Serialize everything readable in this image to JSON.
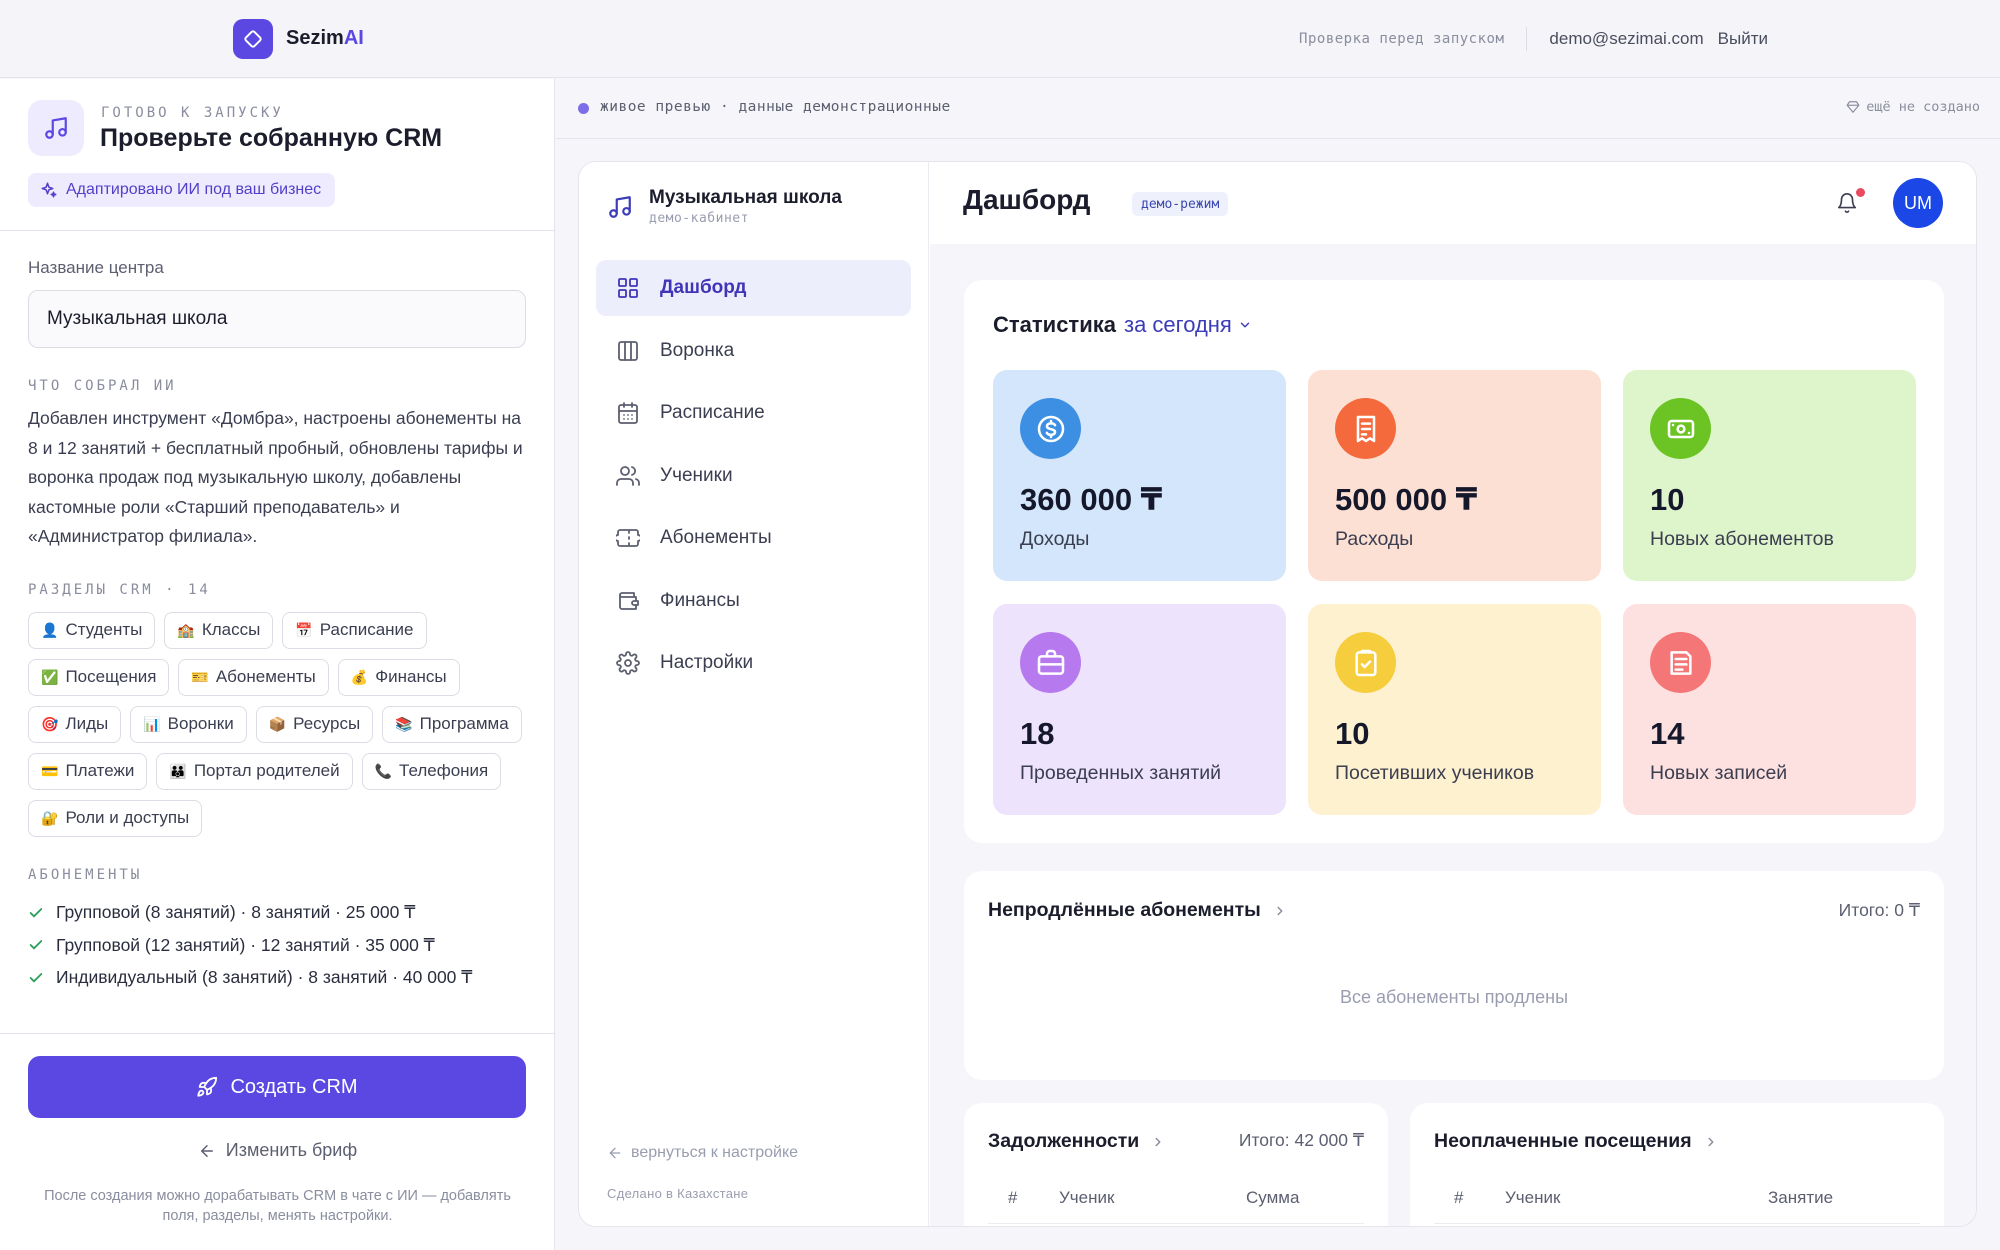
{
  "topbar": {
    "brand_main": "Sezim",
    "brand_accent": "AI",
    "check_label": "Проверка перед запуском",
    "email": "demo@sezimai.com",
    "logout": "Выйти"
  },
  "left": {
    "eyebrow": "ГОТОВО К ЗАПУСКУ",
    "title": "Проверьте собранную CRM",
    "ai_chip": "Адаптировано ИИ под ваш бизнес",
    "center_label": "Название центра",
    "center_value": "Музыкальная школа",
    "ai_section": "ЧТО СОБРАЛ ИИ",
    "ai_text": "Добавлен инструмент «Домбра», настроены абонементы на 8 и 12 занятий + бесплатный пробный, обновлены тарифы и воронка продаж под музыкальную школу, добавлены кастомные роли «Старший преподаватель» и «Администратор филиала».",
    "sections_title": "РАЗДЕЛЫ CRM · 14",
    "sections": [
      {
        "emoji": "👤",
        "label": "Студенты"
      },
      {
        "emoji": "🏫",
        "label": "Классы"
      },
      {
        "emoji": "📅",
        "label": "Расписание"
      },
      {
        "emoji": "✅",
        "label": "Посещения"
      },
      {
        "emoji": "🎫",
        "label": "Абонементы"
      },
      {
        "emoji": "💰",
        "label": "Финансы"
      },
      {
        "emoji": "🎯",
        "label": "Лиды"
      },
      {
        "emoji": "📊",
        "label": "Воронки"
      },
      {
        "emoji": "📦",
        "label": "Ресурсы"
      },
      {
        "emoji": "📚",
        "label": "Программа"
      },
      {
        "emoji": "💳",
        "label": "Платежи"
      },
      {
        "emoji": "👪",
        "label": "Портал родителей"
      },
      {
        "emoji": "📞",
        "label": "Телефония"
      },
      {
        "emoji": "🔐",
        "label": "Роли и доступы"
      }
    ],
    "subs_title": "АБОНЕМЕНТЫ",
    "subs": [
      "Групповой (8 занятий) · 8 занятий · 25 000 ₸",
      "Групповой (12 занятий) · 12 занятий · 35 000 ₸",
      "Индивидуальный (8 занятий) · 8 занятий · 40 000 ₸"
    ],
    "create_button": "Создать CRM",
    "edit_brief": "Изменить бриф",
    "footer_note": "После создания можно дорабатывать CRM в чате с ИИ — добавлять поля, разделы, менять настройки."
  },
  "strip": {
    "status": "живое превью · данные демонстрационные",
    "right": "ещё не создано"
  },
  "preview": {
    "school_name": "Музыкальная школа",
    "school_sub": "демо-кабинет",
    "nav": [
      {
        "label": "Дашборд",
        "icon": "grid-icon",
        "active": true
      },
      {
        "label": "Воронка",
        "icon": "columns-icon",
        "active": false
      },
      {
        "label": "Расписание",
        "icon": "calendar-icon",
        "active": false
      },
      {
        "label": "Ученики",
        "icon": "users-icon",
        "active": false
      },
      {
        "label": "Абонементы",
        "icon": "ticket-icon",
        "active": false
      },
      {
        "label": "Финансы",
        "icon": "wallet-icon",
        "active": false
      },
      {
        "label": "Настройки",
        "icon": "gear-icon",
        "active": false
      }
    ],
    "back_link": "вернуться к настройке",
    "made_in": "Сделано в Казахстане",
    "dash_title": "Дашборд",
    "demo_badge": "демо-режим",
    "avatar": "UM",
    "stats_title": "Статистика",
    "stats_period": "за сегодня",
    "cards": [
      {
        "value": "360 000 ₸",
        "label": "Доходы",
        "bg": "#d3e6fb",
        "icon_bg": "#3d8fe3",
        "icon": "dollar-icon"
      },
      {
        "value": "500 000 ₸",
        "label": "Расходы",
        "bg": "#fde0d4",
        "icon_bg": "#f46a3d",
        "icon": "receipt-icon"
      },
      {
        "value": "10",
        "label": "Новых абонементов",
        "bg": "#def5cc",
        "icon_bg": "#6cc424",
        "icon": "cash-icon"
      },
      {
        "value": "18",
        "label": "Проведенных занятий",
        "bg": "#ede3fd",
        "icon_bg": "#b77aee",
        "icon": "briefcase-icon"
      },
      {
        "value": "10",
        "label": "Посетивших учеников",
        "bg": "#fdf1cf",
        "icon_bg": "#f6cd3c",
        "icon": "clipboard-icon"
      },
      {
        "value": "14",
        "label": "Новых записей",
        "bg": "#fde0e0",
        "icon_bg": "#f47677",
        "icon": "notes-icon"
      }
    ],
    "unrenewed_title": "Непродлённые абонементы",
    "unrenewed_total": "Итого: 0 ₸",
    "unrenewed_empty": "Все абонементы продлены",
    "debts_title": "Задолженности",
    "debts_total": "Итого: 42 000 ₸",
    "debts_cols": [
      "#",
      "Ученик",
      "Сумма"
    ],
    "unpaid_title": "Неоплаченные посещения",
    "unpaid_cols": [
      "#",
      "Ученик",
      "Занятие"
    ]
  },
  "colors": {
    "accent": "#5b48e3",
    "active_nav_bg": "#edeefc",
    "avatar_bg": "#1a47e6",
    "notification_dot": "#e84a5f"
  }
}
